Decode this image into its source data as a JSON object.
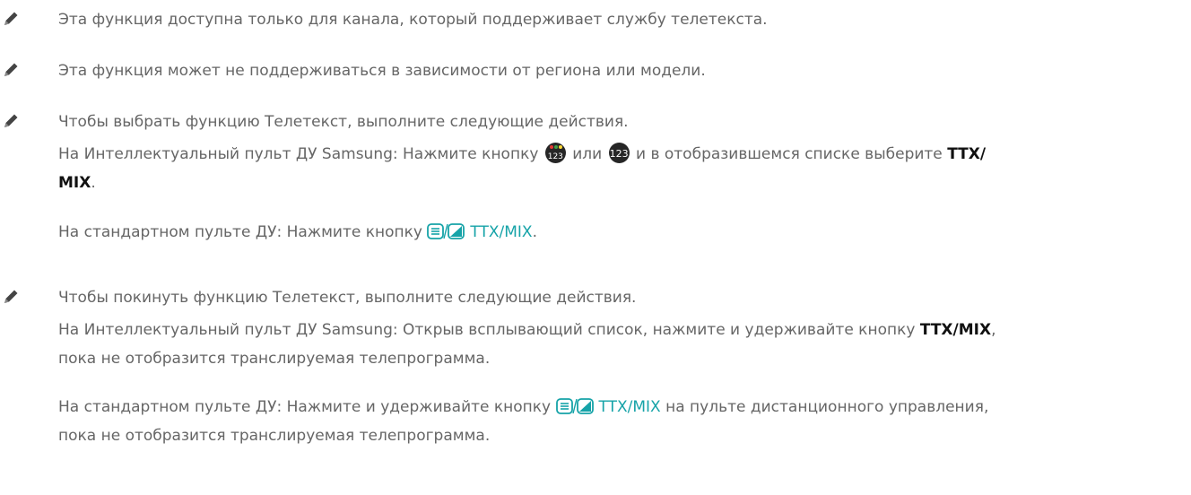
{
  "colors": {
    "text": "#666666",
    "bold": "#111111",
    "teal": "#16a3a8"
  },
  "icons": {
    "note": "pencil-icon",
    "color_keys": "color-keys-button-icon",
    "numeric_keys": "numeric-keys-button-icon",
    "teletext": "teletext-mix-icon"
  },
  "note1": {
    "text": "Эта функция доступна только для канала, который поддерживает службу телетекста."
  },
  "note2": {
    "text": "Эта функция может не поддерживаться в зависимости от региона или модели."
  },
  "note3": {
    "intro": "Чтобы выбрать функцию Телетекст, выполните следующие действия.",
    "smart_prefix": "На Интеллектуальный пульт ДУ Samsung: Нажмите кнопку",
    "smart_or": "или",
    "smart_mid": "и в отобразившемся списке выберите",
    "ttx_part1": "TTX/",
    "ttx_part2": "MIX",
    "smart_end": ".",
    "btn1_label": "123",
    "btn2_label": "123",
    "standard_prefix": "На стандартном пульте ДУ: Нажмите кнопку",
    "standard_key": "TTX/MIX",
    "standard_end": "."
  },
  "note4": {
    "intro": "Чтобы покинуть функцию Телетекст, выполните следующие действия.",
    "smart_prefix": "На Интеллектуальный пульт ДУ Samsung: Открыв всплывающий список, нажмите и удерживайте кнопку",
    "smart_key": "TTX/MIX",
    "smart_end": ",",
    "smart_line2": "пока не отобразится транслируемая телепрограмма.",
    "standard_prefix": "На стандартном пульте ДУ: Нажмите и удерживайте кнопку",
    "standard_key": "TTX/MIX",
    "standard_suffix": "на пульте дистанционного управления,",
    "standard_line2": "пока не отобразится транслируемая телепрограмма."
  }
}
